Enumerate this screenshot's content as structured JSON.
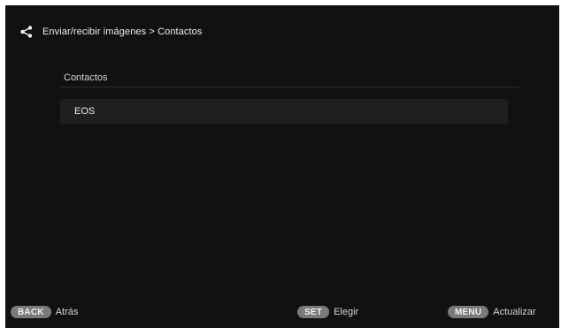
{
  "header": {
    "icon": "share-icon",
    "breadcrumb": "Enviar/recibir imágenes > Contactos"
  },
  "contacts": {
    "section_title": "Contactos",
    "items": [
      {
        "label": "EOS"
      }
    ]
  },
  "footer": {
    "back": {
      "key": "BACK",
      "label": "Atrás"
    },
    "set": {
      "key": "SET",
      "label": "Elegir"
    },
    "menu": {
      "key": "MENU",
      "label": "Actualizar"
    }
  },
  "colors": {
    "background": "#111111",
    "row": "#1f1f1f",
    "pill": "#7a7a7a",
    "text": "#e6e6e6"
  }
}
